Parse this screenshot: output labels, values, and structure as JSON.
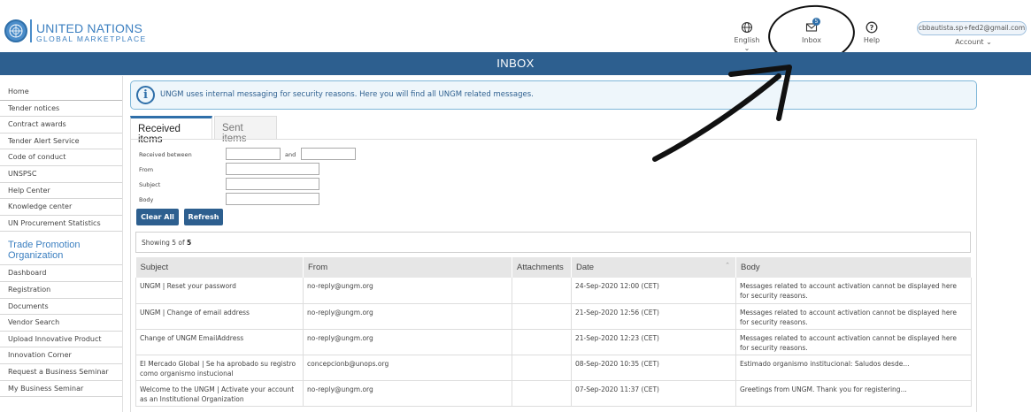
{
  "brand": {
    "line1": "UNITED NATIONS",
    "line2": "GLOBAL MARKETPLACE"
  },
  "header": {
    "language_label": "English",
    "inbox_label": "Inbox",
    "inbox_count": "5",
    "help_label": "Help",
    "account_email": "cbbautista.sp+fed2@gmail.com",
    "account_label": "Account"
  },
  "banner": {
    "title": "INBOX"
  },
  "sidebar": {
    "items": [
      "Home",
      "Tender notices",
      "Contract awards",
      "Tender Alert Service",
      "Code of conduct",
      "UNSPSC",
      "Help Center",
      "Knowledge center",
      "UN Procurement Statistics"
    ],
    "section_title": "Trade Promotion Organization",
    "section_items": [
      "Dashboard",
      "Registration",
      "Documents",
      "Vendor Search",
      "Upload Innovative Product",
      "Innovation Corner",
      "Request a Business Seminar",
      "My Business Seminar"
    ]
  },
  "info": {
    "text": "UNGM uses internal messaging for security reasons. Here you will find all UNGM related messages."
  },
  "tabs": {
    "received": "Received items",
    "sent": "Sent items"
  },
  "filters": {
    "received_between": "Received between",
    "and": "and",
    "from": "From",
    "subject": "Subject",
    "body": "Body",
    "clear_all": "Clear All",
    "refresh": "Refresh"
  },
  "showing": {
    "prefix": "Showing 5 of ",
    "total": "5"
  },
  "table": {
    "headers": [
      "Subject",
      "From",
      "Attachments",
      "Date",
      "Body"
    ],
    "rows": [
      {
        "subject": "UNGM | Reset your password",
        "from": "no-reply@ungm.org",
        "attachments": "",
        "date": "24-Sep-2020 12:00 (CET)",
        "body": "Messages related to account activation cannot be displayed here for security reasons."
      },
      {
        "subject": "UNGM | Change of email address",
        "from": "no-reply@ungm.org",
        "attachments": "",
        "date": "21-Sep-2020 12:56 (CET)",
        "body": "Messages related to account activation cannot be displayed here for security reasons."
      },
      {
        "subject": "Change of UNGM EmailAddress",
        "from": "no-reply@ungm.org",
        "attachments": "",
        "date": "21-Sep-2020 12:23 (CET)",
        "body": "Messages related to account activation cannot be displayed here for security reasons."
      },
      {
        "subject": "El Mercado Global | Se ha aprobado su registro como organismo instucional",
        "from": "concepcionb@unops.org",
        "attachments": "",
        "date": "08-Sep-2020 10:35 (CET)",
        "body": "Estimado organismo institucional: Saludos desde..."
      },
      {
        "subject": "Welcome to the UNGM | Activate your account as an Institutional Organization",
        "from": "no-reply@ungm.org",
        "attachments": "",
        "date": "07-Sep-2020 11:37 (CET)",
        "body": "Greetings from UNGM. Thank you for registering..."
      }
    ]
  },
  "colors": {
    "brand_blue": "#2d5f8f",
    "link_blue": "#3b7fc0"
  }
}
